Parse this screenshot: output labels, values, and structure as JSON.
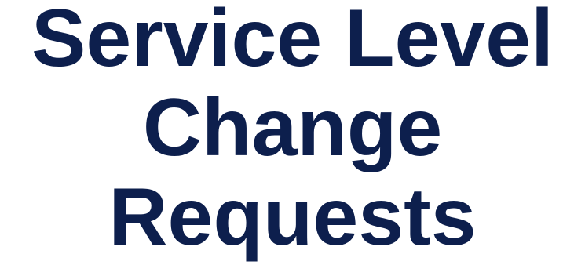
{
  "title": {
    "lines": [
      "Service Level",
      "Change",
      "Requests"
    ],
    "color": "#0d1f4d"
  }
}
